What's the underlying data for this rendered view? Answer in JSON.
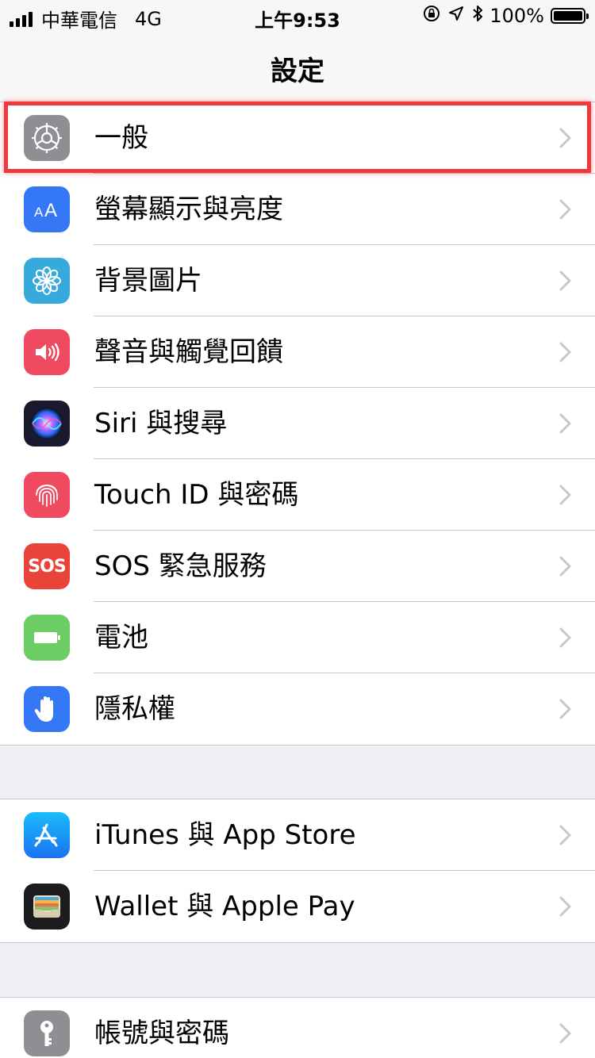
{
  "status_bar": {
    "carrier": "中華電信",
    "network": "4G",
    "time": "上午9:53",
    "battery": "100%"
  },
  "nav": {
    "title": "設定"
  },
  "groups": [
    {
      "items": [
        {
          "label": "一般",
          "icon": "gear-icon",
          "color": "#8e8e93"
        },
        {
          "label": "螢幕顯示與亮度",
          "icon": "text-size-icon",
          "color": "#3478f6"
        },
        {
          "label": "背景圖片",
          "icon": "flower-icon",
          "color": "#36aadc"
        },
        {
          "label": "聲音與觸覺回饋",
          "icon": "speaker-icon",
          "color": "#ef4a5f"
        },
        {
          "label": "Siri 與搜尋",
          "icon": "siri-icon",
          "color": "#1a1a2e"
        },
        {
          "label": "Touch ID 與密碼",
          "icon": "fingerprint-icon",
          "color": "#ef4a5f"
        },
        {
          "label": "SOS 緊急服務",
          "icon": "sos-icon",
          "color": "#e9443a",
          "icon_text": "SOS"
        },
        {
          "label": "電池",
          "icon": "battery-icon",
          "color": "#6ccd64"
        },
        {
          "label": "隱私權",
          "icon": "hand-icon",
          "color": "#3478f6"
        }
      ]
    },
    {
      "items": [
        {
          "label": "iTunes 與 App Store",
          "icon": "app-store-icon",
          "color": "#2a8cf4"
        },
        {
          "label": "Wallet 與 Apple Pay",
          "icon": "wallet-icon",
          "color": "#1c1c1e"
        }
      ]
    },
    {
      "items": [
        {
          "label": "帳號與密碼",
          "icon": "key-icon",
          "color": "#8e8e93"
        }
      ]
    }
  ]
}
